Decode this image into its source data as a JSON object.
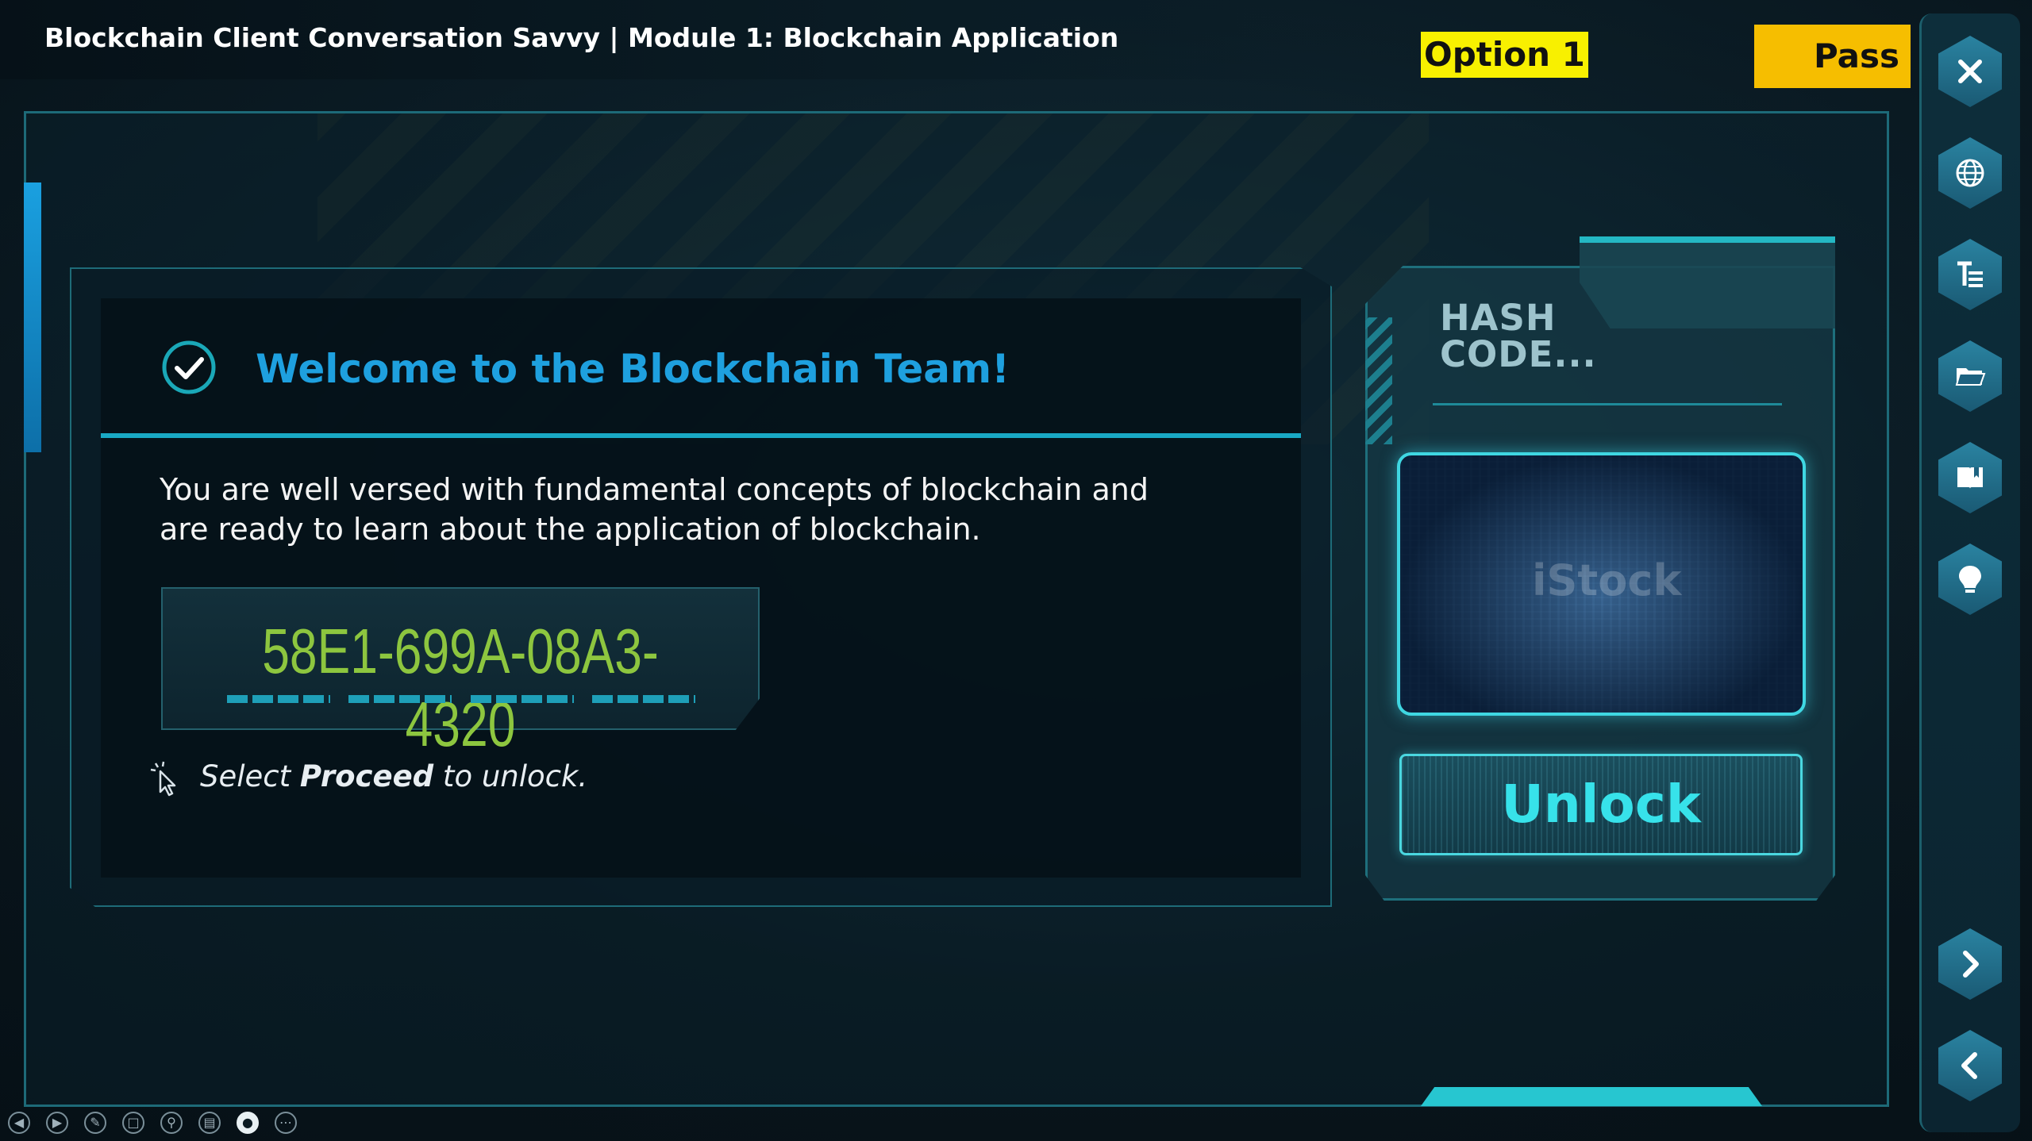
{
  "header": {
    "course_title": "Blockchain Client Conversation Savvy | Module 1: Blockchain Application",
    "option_badge": "Option 1",
    "pass_badge": "Pass"
  },
  "content": {
    "title": "Welcome to the Blockchain Team!",
    "body": "You are well versed with fundamental concepts of blockchain and are ready to learn about the application of blockchain.",
    "hash_code": "58E1-699A-08A3-4320",
    "instruction_prefix": "Select ",
    "instruction_bold": "Proceed",
    "instruction_suffix": " to unlock."
  },
  "hash_panel": {
    "label_line1": "HASH",
    "label_line2": "CODE...",
    "watermark": "iStock",
    "unlock_label": "Unlock"
  },
  "sidebar": {
    "items": [
      "close-icon",
      "globe-icon",
      "transcript-icon",
      "folder-icon",
      "book-icon",
      "lightbulb-icon",
      "next-icon",
      "back-icon"
    ]
  },
  "toolbar": {
    "items": [
      "prev-icon",
      "play-icon",
      "pen-icon",
      "copy-icon",
      "zoom-icon",
      "captions-icon",
      "camera-icon",
      "more-icon"
    ]
  },
  "colors": {
    "accent_blue": "#1ea0df",
    "hash_green": "#8dc63f",
    "unlock_cyan": "#37e2ea",
    "option_yellow": "#f8f000",
    "pass_yellow": "#f6be00"
  }
}
